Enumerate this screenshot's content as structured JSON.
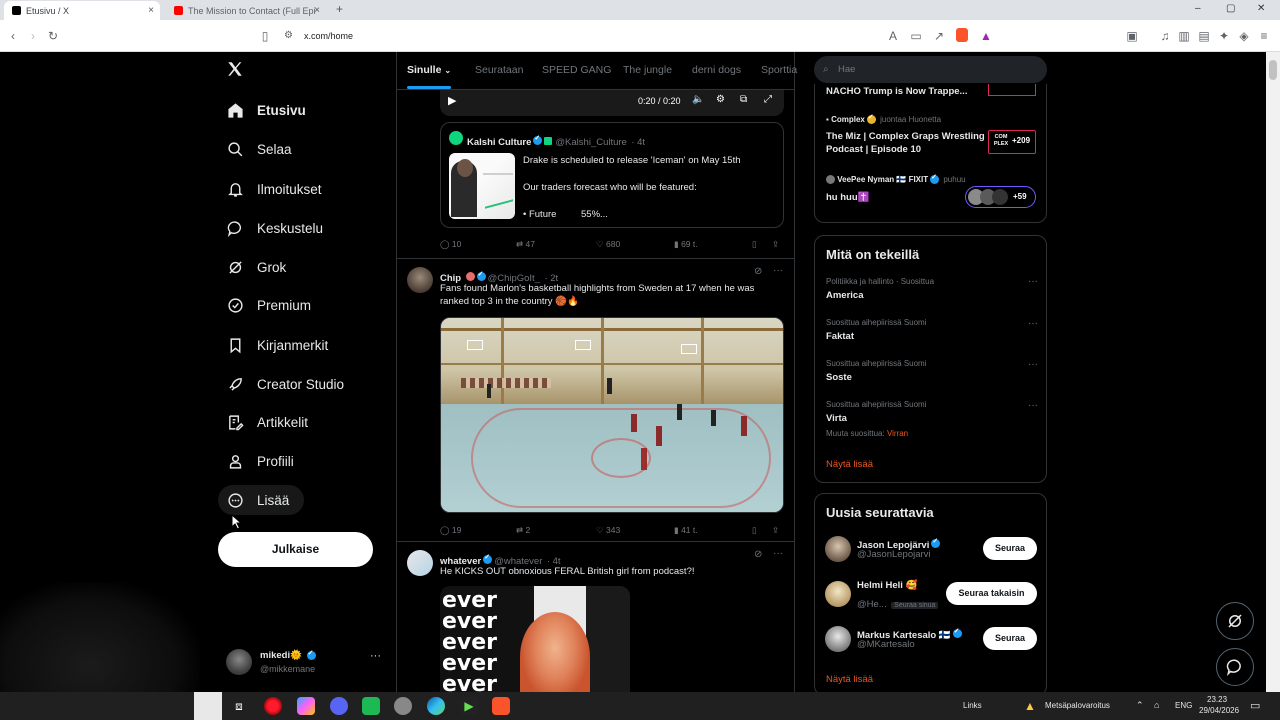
{
  "browser": {
    "tabs": [
      {
        "title": "Etusivu / X",
        "close": "×"
      },
      {
        "title": "The Mission to Contact (Full Episode",
        "close": "×"
      }
    ],
    "new_tab": "+",
    "url": "x.com/home",
    "window_controls": {
      "min": "–",
      "max": "▢",
      "close": "✕"
    }
  },
  "sidebar": {
    "items": [
      {
        "label": "Etusivu",
        "icon": "home-icon"
      },
      {
        "label": "Selaa",
        "icon": "search-icon"
      },
      {
        "label": "Ilmoitukset",
        "icon": "bell-icon"
      },
      {
        "label": "Keskustelu",
        "icon": "chat-icon"
      },
      {
        "label": "Grok",
        "icon": "grok-icon"
      },
      {
        "label": "Premium",
        "icon": "premium-icon"
      },
      {
        "label": "Kirjanmerkit",
        "icon": "bookmark-icon"
      },
      {
        "label": "Creator Studio",
        "icon": "rocket-icon"
      },
      {
        "label": "Artikkelit",
        "icon": "article-icon"
      },
      {
        "label": "Profiili",
        "icon": "person-icon"
      },
      {
        "label": "Lisää",
        "icon": "more-circle-icon"
      }
    ],
    "post_button": "Julkaise",
    "account": {
      "name": "mikedi",
      "emoji": "🌞",
      "handle": "@mikkemane",
      "more": "···"
    }
  },
  "feed": {
    "tabs": [
      "Sinulle",
      "Seurataan",
      "SPEED GANG",
      "The jungle",
      "derni dogs",
      "Sporttia"
    ],
    "video_controls": {
      "time": "0:20 / 0:20"
    },
    "quote": {
      "name": "Kalshi Culture",
      "handle": "@Kalshi_Culture",
      "time": "· 4t",
      "line1": "Drake is scheduled to release 'Iceman' on May 15th",
      "line2": "Our traders forecast who will be featured:",
      "line3": "• Future",
      "line3b": "55%..."
    },
    "tweet1_actions": {
      "replies": "10",
      "retweets": "47",
      "likes": "680",
      "views": "69 t."
    },
    "tweet2": {
      "name": "Chip",
      "handle": "@ChipGoIt_",
      "time": "· 2t",
      "text": "Fans found Marlon's basketball highlights from Sweden at 17 when he was ranked top 3 in the country 🏀🔥",
      "actions": {
        "replies": "19",
        "retweets": "2",
        "likes": "343",
        "views": "41 t."
      }
    },
    "tweet3": {
      "name": "whatever",
      "handle": "@whatever",
      "time": "· 4t",
      "text": "He KICKS OUT obnoxious FERAL British girl from podcast?!",
      "image_text": "ever ever ever ever ever"
    }
  },
  "right": {
    "search_placeholder": "Hae",
    "live": [
      {
        "title": "NACHO Trump is Now Trappe..."
      },
      {
        "user": "Complex",
        "action": "juontaa Huonetta",
        "title": "The Miz | Complex Graps Wrestling Podcast | Episode 10",
        "badge": "COM PLEX",
        "count": "+209"
      },
      {
        "user": "VeePee Nyman 🇫🇮 FIXIT",
        "action": "puhuu",
        "title": "hu huu✝️",
        "count": "+59"
      }
    ],
    "trends_title": "Mitä on tekeillä",
    "trends": [
      {
        "meta": "Politiikka ja hallinto · Suosittua",
        "name": "America"
      },
      {
        "meta": "Suosittua aihepiirissä Suomi",
        "name": "Faktat"
      },
      {
        "meta": "Suosittua aihepiirissä Suomi",
        "name": "Soste"
      },
      {
        "meta": "Suosittua aihepiirissä Suomi",
        "name": "Virta",
        "extra_label": "Muuta suosittua:",
        "extra_value": "Virran"
      }
    ],
    "trends_more": "Näytä lisää",
    "who_title": "Uusia seurattavia",
    "who": [
      {
        "name": "Jason Lepojärvi",
        "handle": "@JasonLepojarvi",
        "button": "Seuraa"
      },
      {
        "name": "Helmi Heli 🥰",
        "handle": "@He...",
        "follows_you": "Seuraa sinua",
        "button": "Seuraa takaisin"
      },
      {
        "name": "Markus Kartesalo 🇫🇮",
        "handle": "@MKartesalo",
        "button": "Seuraa"
      }
    ],
    "who_more": "Näytä lisää"
  },
  "taskbar": {
    "links": "Links",
    "weather": "Metsäpalovaroitus",
    "lang": "ENG",
    "time": "23.23",
    "date": "29/04/2026"
  },
  "colors": {
    "accent": "#1d9bf0",
    "link": "#e8571f",
    "bg": "#000000",
    "border": "#2f3336"
  }
}
